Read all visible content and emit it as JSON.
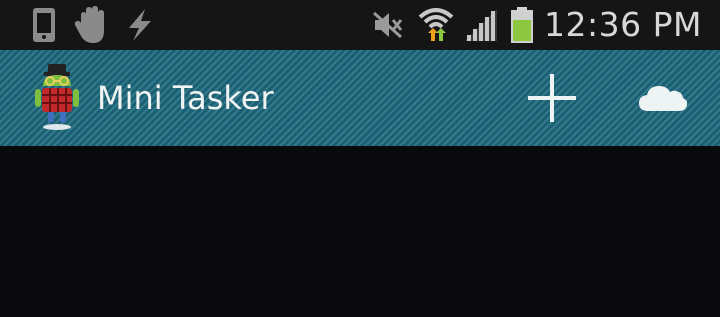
{
  "status_bar": {
    "time": "12:36 PM",
    "icons": [
      "phone-icon",
      "hand-icon",
      "flash-icon",
      "mute-icon",
      "wifi-icon",
      "signal-icon",
      "battery-icon"
    ],
    "battery_color": "#8dc63f"
  },
  "action_bar": {
    "title": "Mini Tasker",
    "background_color": "#1d6b7f",
    "actions": [
      "add-icon",
      "cloud-sync-icon"
    ]
  }
}
